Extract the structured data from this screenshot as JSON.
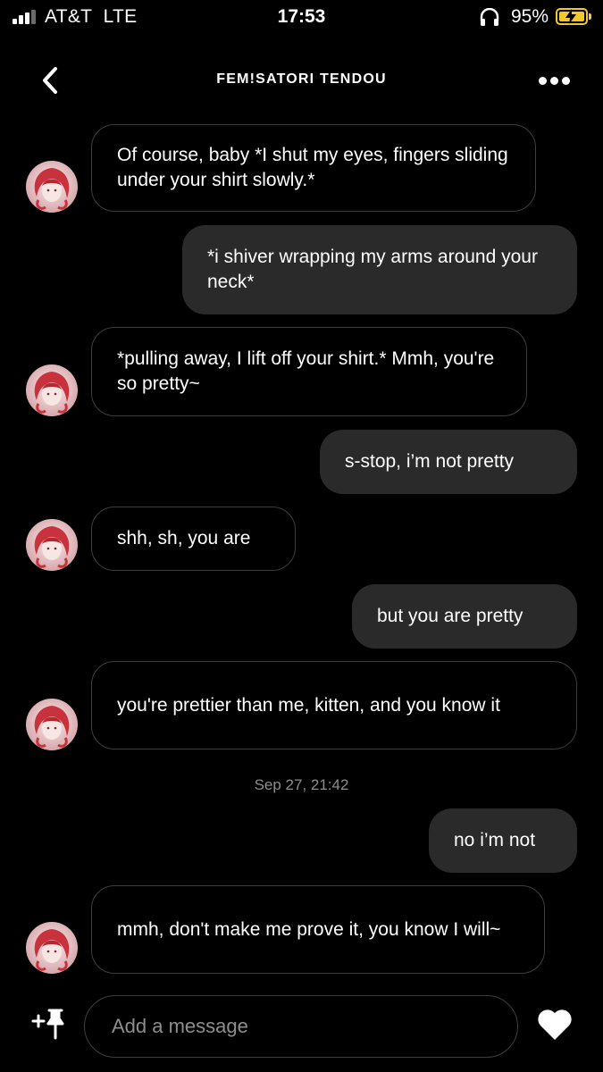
{
  "status_bar": {
    "carrier": "AT&T",
    "network": "LTE",
    "time": "17:53",
    "battery_percent": "95%",
    "signal_bars": 3,
    "icons": [
      "signal-icon",
      "headphones-icon",
      "battery-charging-icon"
    ],
    "battery_color": "#f4c82a"
  },
  "header": {
    "title": "FEM!SATORI TENDOU",
    "icons": [
      "back-chevron-icon",
      "more-options-icon"
    ]
  },
  "messages": [
    {
      "sender": "character",
      "text": "Of course, baby *I shut my eyes, fingers sliding under your shirt slowly.*"
    },
    {
      "sender": "user",
      "text": "*i shiver wrapping my arms around your neck*"
    },
    {
      "sender": "character",
      "text": "*pulling away, I lift off your shirt.* Mmh, you're so pretty~"
    },
    {
      "sender": "user",
      "text": "s-stop, i’m not pretty"
    },
    {
      "sender": "character",
      "text": "shh, sh, you are"
    },
    {
      "sender": "user",
      "text": "but you are pretty"
    },
    {
      "sender": "character",
      "text": "you're prettier than me, kitten, and you know it"
    },
    {
      "sender": "user",
      "text": "no i’m not"
    },
    {
      "sender": "character",
      "text": "mmh, don't make me prove it, you know I will~"
    }
  ],
  "timestamp": "Sep 27, 21:42",
  "composer": {
    "placeholder": "Add a message",
    "value": "",
    "icons": [
      "add-pin-icon",
      "heart-icon"
    ]
  },
  "colors": {
    "background": "#000000",
    "sent_bubble": "#2a2a2a",
    "received_border": "#3e3e3e",
    "muted_text": "#8e8e8e"
  }
}
